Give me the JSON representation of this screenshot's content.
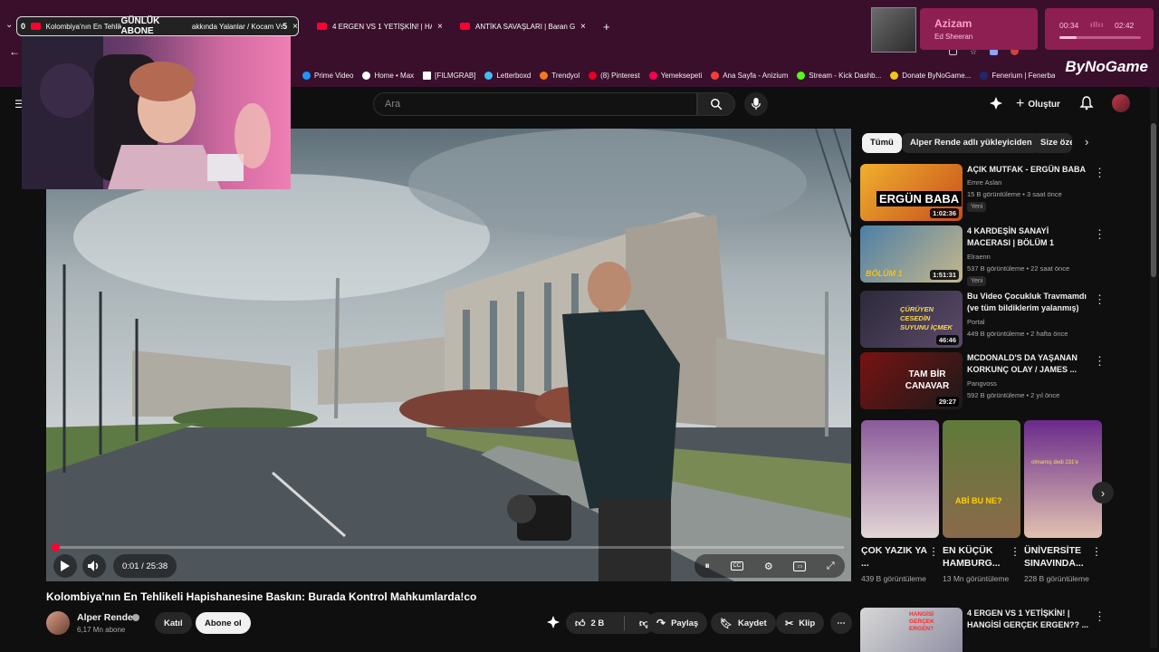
{
  "browser": {
    "tabs": [
      {
        "label": "Kolombiya'nın En Tehlike"
      },
      {
        "label": "4 ERGEN VS 1 YETİŞKİN! | HANG"
      },
      {
        "label": "ANTİKA SAVAŞLARI | Baran Güv"
      }
    ],
    "overlay_banner": "GÜNLÜK ABONE",
    "overlay_prefix": "0",
    "overlay_suffix_text": "akkında Yalanlar / Kocam Vs",
    "overlay_count": "5",
    "bookmarks": [
      {
        "label": "Prime Video",
        "color": "#1a98ff"
      },
      {
        "label": "Home • Max",
        "color": "#ffffff"
      },
      {
        "label": "[FILMGRAB]",
        "color": "#ffffff"
      },
      {
        "label": "Letterboxd",
        "color": "#40bcf4"
      },
      {
        "label": "Trendyol",
        "color": "#f27a1a"
      },
      {
        "label": "(8) Pinterest",
        "color": "#e60023"
      },
      {
        "label": "Yemeksepeti",
        "color": "#fa0050"
      },
      {
        "label": "Ana Sayfa - Anizium",
        "color": "#ff3b3b"
      },
      {
        "label": "Stream - Kick Dashb...",
        "color": "#53fc18"
      },
      {
        "label": "Donate ByNoGame...",
        "color": "#f5c518"
      },
      {
        "label": "Fenerium | Fenerba...",
        "color": "#1b2a6b"
      }
    ],
    "brand": "ByNoGame"
  },
  "now_playing": {
    "song": "Azizam",
    "artist": "Ed Sheeran",
    "elapsed": "00:34",
    "total": "02:42",
    "progress": 0.21
  },
  "youtube": {
    "search_placeholder": "Ara",
    "create_label": "Oluştur",
    "player": {
      "time": "0:01 / 25:38",
      "progress": 0.001
    },
    "video_title": "Kolombiya'nın En Tehlikeli Hapishanesine Baskın: Burada Kontrol Mahkumlarda!co",
    "channel": {
      "name": "Alper Rende",
      "subs": "6,17 Mn abone",
      "join": "Katıl",
      "subscribe": "Abone ol"
    },
    "actions": {
      "likes": "2 B",
      "share": "Paylaş",
      "save": "Kaydet",
      "clip": "Klip"
    },
    "chips": [
      "Tümü",
      "Alper Rende adlı yükleyiciden",
      "Size öze"
    ],
    "recommendations": [
      {
        "title": "AÇIK MUTFAK - ERGÜN BABA",
        "channel": "Emre Aslan",
        "meta": "15 B görüntüleme • 3 saat önce",
        "badge": "Yeni",
        "duration": "1:02:36",
        "thumb_text": "ERGÜN BABA"
      },
      {
        "title": "4 KARDEŞİN SANAYİ MACERASI | BÖLÜM 1",
        "channel": "Elraenn",
        "meta": "537 B görüntüleme • 22 saat önce",
        "badge": "Yeni",
        "duration": "1:51:31",
        "thumb_text": "BÖLÜM 1"
      },
      {
        "title": "Bu Video Çocukluk Travmamdı (ve tüm bildiklerim yalanmış)",
        "channel": "Portal",
        "meta": "449 B görüntüleme • 2 hafta önce",
        "badge": "",
        "duration": "46:46",
        "thumb_text": "ÇÜRÜYEN CESEDİN SUYUNU İÇMEK"
      },
      {
        "title": "MCDONALD'S DA YAŞANAN KORKUNÇ OLAY / JAMES ...",
        "channel": "Pangvoss",
        "meta": "592 B görüntüleme • 2 yıl önce",
        "badge": "",
        "duration": "29:27",
        "thumb_text": "TAM BİR CANAVAR"
      }
    ],
    "shorts": [
      {
        "title": "ÇOK YAZIK YA ...",
        "views": "439 B görüntüleme",
        "thumb_text": ""
      },
      {
        "title": "EN KÜÇÜK HAMBURG...",
        "views": "13 Mn görüntüleme",
        "thumb_text": "ABİ BU NE?"
      },
      {
        "title": "ÜNİVERSİTE SINAVINDA...",
        "views": "228 B görüntüleme",
        "thumb_text": "olmamış dedi 231'e"
      }
    ],
    "next_rec": {
      "title": "4 ERGEN VS 1 YETİŞKİN! | HANGİSİ GERÇEK ERGEN?? ...",
      "thumb_text": "HANGİSİ GERÇEK ERGEN?"
    }
  }
}
